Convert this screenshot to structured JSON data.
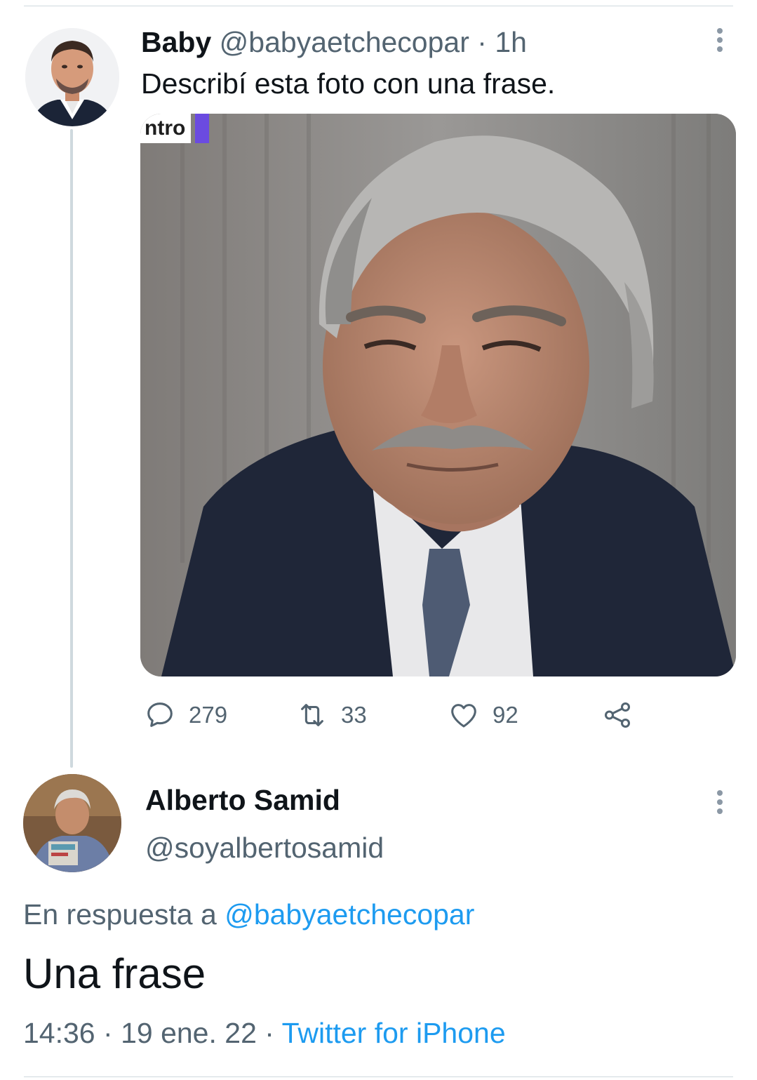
{
  "tweet": {
    "author_name": "Baby",
    "author_handle": "@babyaetchecopar",
    "separator": "·",
    "time": "1h",
    "text": "Describí esta foto con una frase.",
    "media_label": "ntro",
    "stats": {
      "replies": "279",
      "retweets": "33",
      "likes": "92"
    }
  },
  "reply": {
    "author_name": "Alberto Samid",
    "author_handle": "@soyalbertosamid",
    "reply_prefix": "En respuesta a",
    "reply_mention": "@babyaetchecopar",
    "text": "Una frase",
    "time": "14:36",
    "separator": "·",
    "date": "19 ene. 22",
    "source": "Twitter for iPhone"
  },
  "colors": {
    "text_primary": "#0f1419",
    "text_secondary": "#536471",
    "link": "#1d9bf0",
    "divider": "#cfd9de"
  },
  "icons": {
    "reply": "speech-bubble-icon",
    "retweet": "retweet-icon",
    "like": "heart-icon",
    "share": "share-icon",
    "more": "more-vertical-icon"
  }
}
